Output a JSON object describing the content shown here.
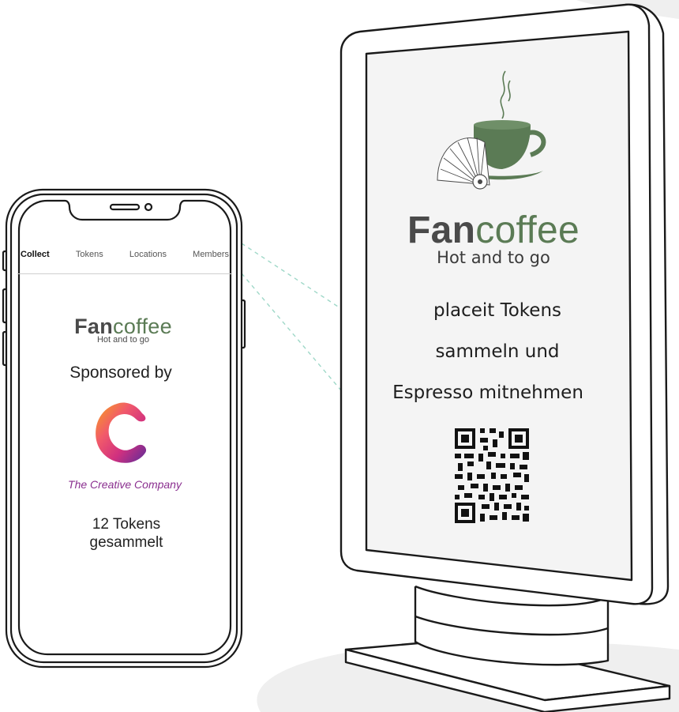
{
  "phone": {
    "tabs": [
      {
        "label": "Collect",
        "active": true
      },
      {
        "label": "Tokens",
        "active": false
      },
      {
        "label": "Locations",
        "active": false
      },
      {
        "label": "Members",
        "active": false
      }
    ],
    "brand": {
      "name_part1": "Fan",
      "name_part2": "coffee",
      "tagline": "Hot and to go"
    },
    "sponsored_label": "Sponsored by",
    "sponsor": {
      "logo_letter": "C",
      "name": "The Creative Company"
    },
    "tokens": {
      "line1": "12 Tokens",
      "line2": "gesammelt"
    }
  },
  "kiosk": {
    "brand": {
      "name_part1": "Fan",
      "name_part2": "coffee",
      "tagline": "Hot and to go"
    },
    "message": [
      "placeit Tokens",
      "sammeln und",
      "Espresso mitnehmen"
    ],
    "qr_icon": "qr-code-icon"
  },
  "colors": {
    "brand_dark": "#4a4a4a",
    "brand_green": "#5b7b55",
    "cup_green": "#5b7b55",
    "sponsor_text": "#8a2f8f",
    "outline": "#1a1a1a",
    "connector": "#9fd8c8",
    "floor": "#efefef"
  }
}
